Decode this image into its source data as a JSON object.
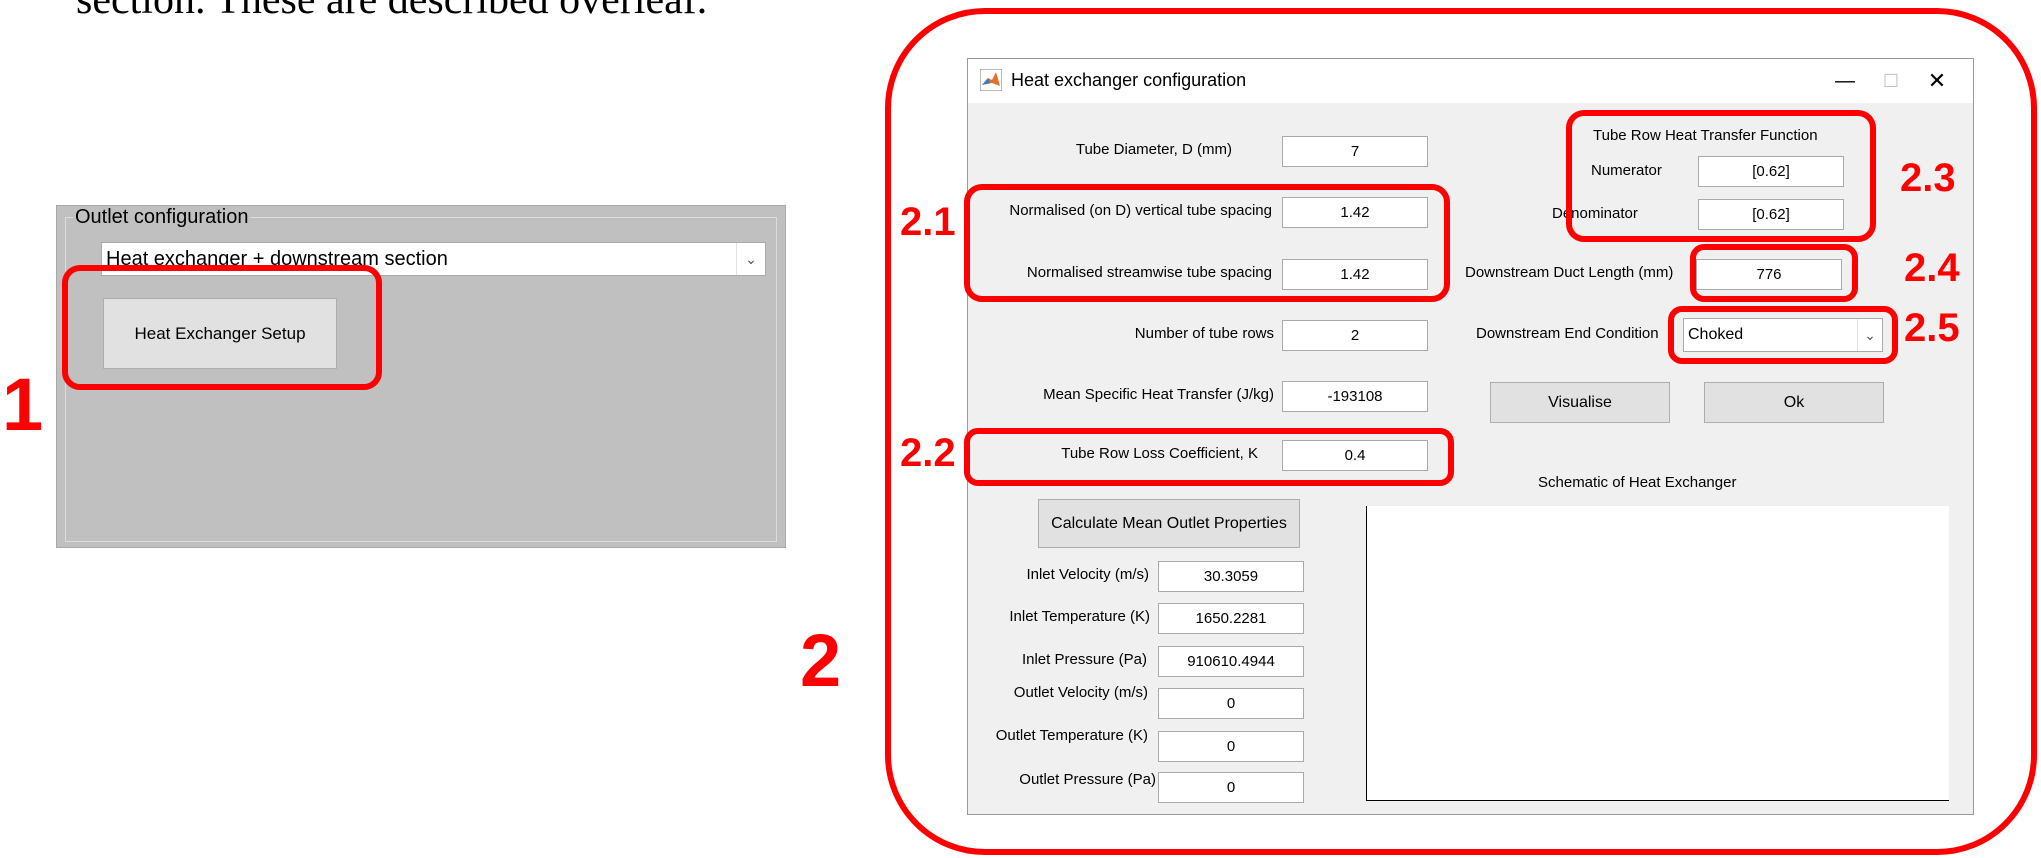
{
  "document": {
    "fragment_text": "section. These are described overleaf."
  },
  "annotations": {
    "label_1": "1",
    "label_2": "2",
    "label_2_1": "2.1",
    "label_2_2": "2.2",
    "label_2_3": "2.3",
    "label_2_4": "2.4",
    "label_2_5": "2.5",
    "highlight_color": "#ff0000"
  },
  "outlet_panel": {
    "group_title": "Outlet configuration",
    "dropdown_value": "Heat exchanger + downstream section",
    "setup_button_label": "Heat Exchanger Setup"
  },
  "window": {
    "title": "Heat exchanger configuration",
    "controls": {
      "minimize": "—",
      "maximize": "☐",
      "close": "✕"
    },
    "fields": {
      "tube_diameter": {
        "label": "Tube Diameter, D (mm)",
        "value": "7"
      },
      "vertical_spacing": {
        "label": "Normalised (on D) vertical tube spacing",
        "value": "1.42"
      },
      "streamwise_spacing": {
        "label": "Normalised streamwise tube spacing",
        "value": "1.42"
      },
      "tube_rows": {
        "label": "Number of tube rows",
        "value": "2"
      },
      "mean_heat_transfer": {
        "label": "Mean Specific Heat Transfer (J/kg)",
        "value": "-193108"
      },
      "loss_coefficient": {
        "label": "Tube Row Loss Coefficient, K",
        "value": "0.4"
      }
    },
    "transfer_function": {
      "title": "Tube Row Heat Transfer Function",
      "numerator_label": "Numerator",
      "numerator_value": "[0.62]",
      "denominator_label": "Denominator",
      "denominator_value": "[0.62]"
    },
    "downstream": {
      "duct_length_label": "Downstream Duct Length (mm)",
      "duct_length_value": "776",
      "end_condition_label": "Downstream End Condition",
      "end_condition_value": "Choked"
    },
    "buttons": {
      "visualise": "Visualise",
      "ok": "Ok",
      "calculate": "Calculate Mean Outlet Properties"
    },
    "schematic_title": "Schematic of Heat Exchanger",
    "properties": [
      {
        "label": "Inlet Velocity (m/s)",
        "value": "30.3059"
      },
      {
        "label": "Inlet Temperature (K)",
        "value": "1650.2281"
      },
      {
        "label": "Inlet Pressure (Pa)",
        "value": "910610.4944"
      },
      {
        "label": "Outlet Velocity (m/s)",
        "value": "0"
      },
      {
        "label": "Outlet Temperature (K)",
        "value": "0"
      },
      {
        "label": "Outlet Pressure (Pa)",
        "value": "0"
      }
    ]
  }
}
